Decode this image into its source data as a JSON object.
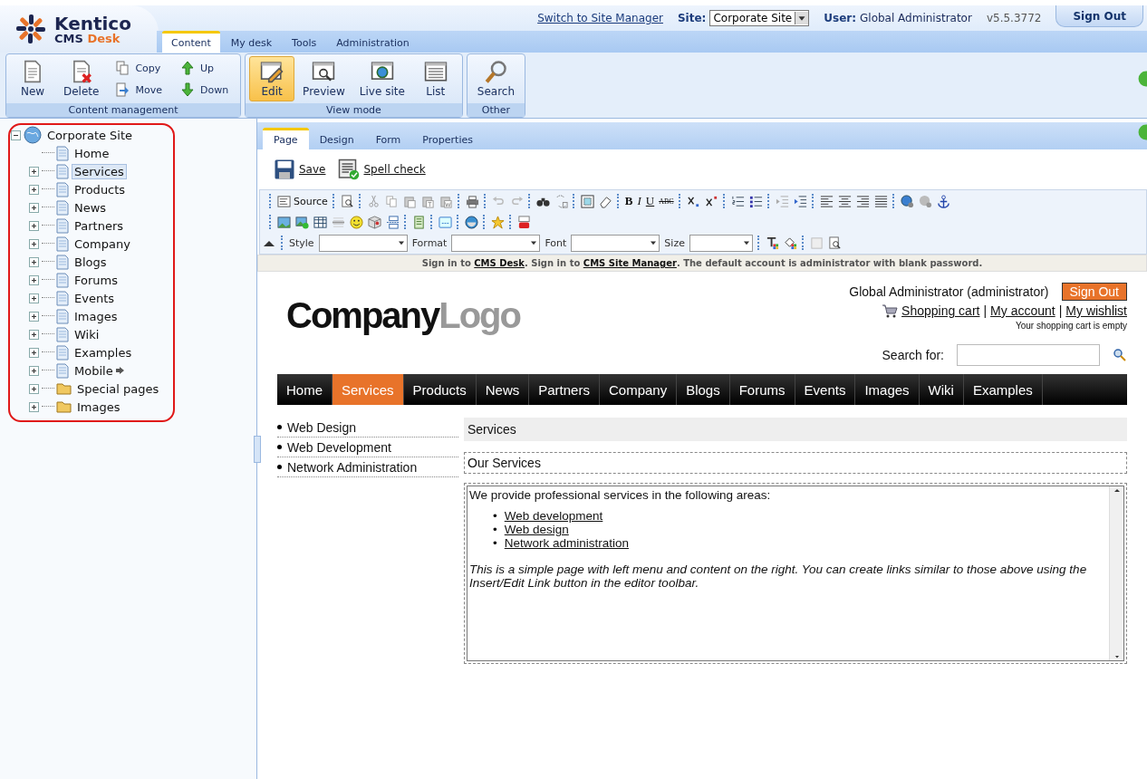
{
  "header": {
    "brand": "Kentico",
    "product": "CMS",
    "product_accent": "Desk",
    "switch_link": "Switch to Site Manager",
    "site_label": "Site:",
    "site_value": "Corporate Site",
    "user_label": "User:",
    "user_name": "Global Administrator",
    "version": "v5.5.3772",
    "sign_out": "Sign Out",
    "tabs": [
      {
        "label": "Content",
        "selected": true
      },
      {
        "label": "My desk",
        "selected": false
      },
      {
        "label": "Tools",
        "selected": false
      },
      {
        "label": "Administration",
        "selected": false
      }
    ]
  },
  "ribbon": {
    "groups": [
      {
        "title": "Content management",
        "buttons": [
          {
            "label": "New",
            "kind": "large",
            "selected": false
          },
          {
            "label": "Delete",
            "kind": "large",
            "selected": false
          },
          {
            "label": "Copy",
            "kind": "small",
            "selected": false
          },
          {
            "label": "Move",
            "kind": "small",
            "selected": false
          },
          {
            "label": "Up",
            "kind": "small",
            "selected": false
          },
          {
            "label": "Down",
            "kind": "small",
            "selected": false
          }
        ]
      },
      {
        "title": "View mode",
        "buttons": [
          {
            "label": "Edit",
            "kind": "large",
            "selected": true
          },
          {
            "label": "Preview",
            "kind": "large",
            "selected": false
          },
          {
            "label": "Live site",
            "kind": "large",
            "selected": false
          },
          {
            "label": "List",
            "kind": "large",
            "selected": false
          }
        ]
      },
      {
        "title": "Other",
        "buttons": [
          {
            "label": "Search",
            "kind": "large",
            "selected": false
          }
        ]
      }
    ]
  },
  "tree": {
    "root": {
      "label": "Corporate Site",
      "expanded": true,
      "selected": false,
      "children": [
        {
          "label": "Home",
          "kind": "page",
          "selected": false,
          "linked": false
        },
        {
          "label": "Services",
          "kind": "page",
          "expanded": false,
          "selected": true,
          "linked": false
        },
        {
          "label": "Products",
          "kind": "page",
          "expanded": false,
          "selected": false,
          "linked": false
        },
        {
          "label": "News",
          "kind": "page",
          "expanded": false,
          "selected": false,
          "linked": false
        },
        {
          "label": "Partners",
          "kind": "page",
          "expanded": false,
          "selected": false,
          "linked": false
        },
        {
          "label": "Company",
          "kind": "page",
          "expanded": false,
          "selected": false,
          "linked": false
        },
        {
          "label": "Blogs",
          "kind": "page",
          "expanded": false,
          "selected": false,
          "linked": false
        },
        {
          "label": "Forums",
          "kind": "page",
          "expanded": false,
          "selected": false,
          "linked": false
        },
        {
          "label": "Events",
          "kind": "page",
          "expanded": false,
          "selected": false,
          "linked": false
        },
        {
          "label": "Images",
          "kind": "page",
          "expanded": false,
          "selected": false,
          "linked": false
        },
        {
          "label": "Wiki",
          "kind": "page",
          "expanded": false,
          "selected": false,
          "linked": false
        },
        {
          "label": "Examples",
          "kind": "page",
          "expanded": false,
          "selected": false,
          "linked": false
        },
        {
          "label": "Mobile",
          "kind": "page",
          "expanded": false,
          "selected": false,
          "linked": true
        },
        {
          "label": "Special pages",
          "kind": "folder",
          "expanded": false,
          "selected": false,
          "linked": false
        },
        {
          "label": "Images",
          "kind": "folder",
          "expanded": false,
          "selected": false,
          "linked": false
        }
      ]
    }
  },
  "content_tabs": [
    {
      "label": "Page",
      "selected": true
    },
    {
      "label": "Design",
      "selected": false
    },
    {
      "label": "Form",
      "selected": false
    },
    {
      "label": "Properties",
      "selected": false
    }
  ],
  "actions": {
    "save": "Save",
    "spell_check": "Spell check"
  },
  "editor": {
    "source": "Source",
    "bold": "B",
    "italic": "I",
    "underline": "U",
    "strike": "ABC",
    "dropdowns": [
      "Style",
      "Format",
      "Font",
      "Size"
    ]
  },
  "notice": "Sign in to **CMS Desk**. Sign in to **CMS Site Manager**. The default account is administrator with blank password.",
  "site": {
    "logo_main": "Company",
    "logo_accent": "Logo",
    "user_line": "Global Administrator (administrator)",
    "sign_out": "Sign Out",
    "links": [
      "Shopping cart",
      "My account",
      "My wishlist"
    ],
    "separator": "|",
    "cart_status": "Your shopping cart is empty",
    "search_label": "Search for:",
    "nav": [
      {
        "label": "Home",
        "selected": false
      },
      {
        "label": "Services",
        "selected": true
      },
      {
        "label": "Products",
        "selected": false
      },
      {
        "label": "News",
        "selected": false
      },
      {
        "label": "Partners",
        "selected": false
      },
      {
        "label": "Company",
        "selected": false
      },
      {
        "label": "Blogs",
        "selected": false
      },
      {
        "label": "Forums",
        "selected": false
      },
      {
        "label": "Events",
        "selected": false
      },
      {
        "label": "Images",
        "selected": false
      },
      {
        "label": "Wiki",
        "selected": false
      },
      {
        "label": "Examples",
        "selected": false
      }
    ],
    "left_menu": [
      "Web Design",
      "Web Development",
      "Network Administration"
    ],
    "heading": "Services",
    "subheading": "Our Services",
    "intro": "We provide professional services in the following areas:",
    "service_links": [
      "Web development",
      "Web design",
      "Network administration"
    ],
    "bullet": "•",
    "note": "This is a simple page with left menu and content on the right. You can create links similar to those above using the Insert/Edit Link button in the editor toolbar."
  }
}
